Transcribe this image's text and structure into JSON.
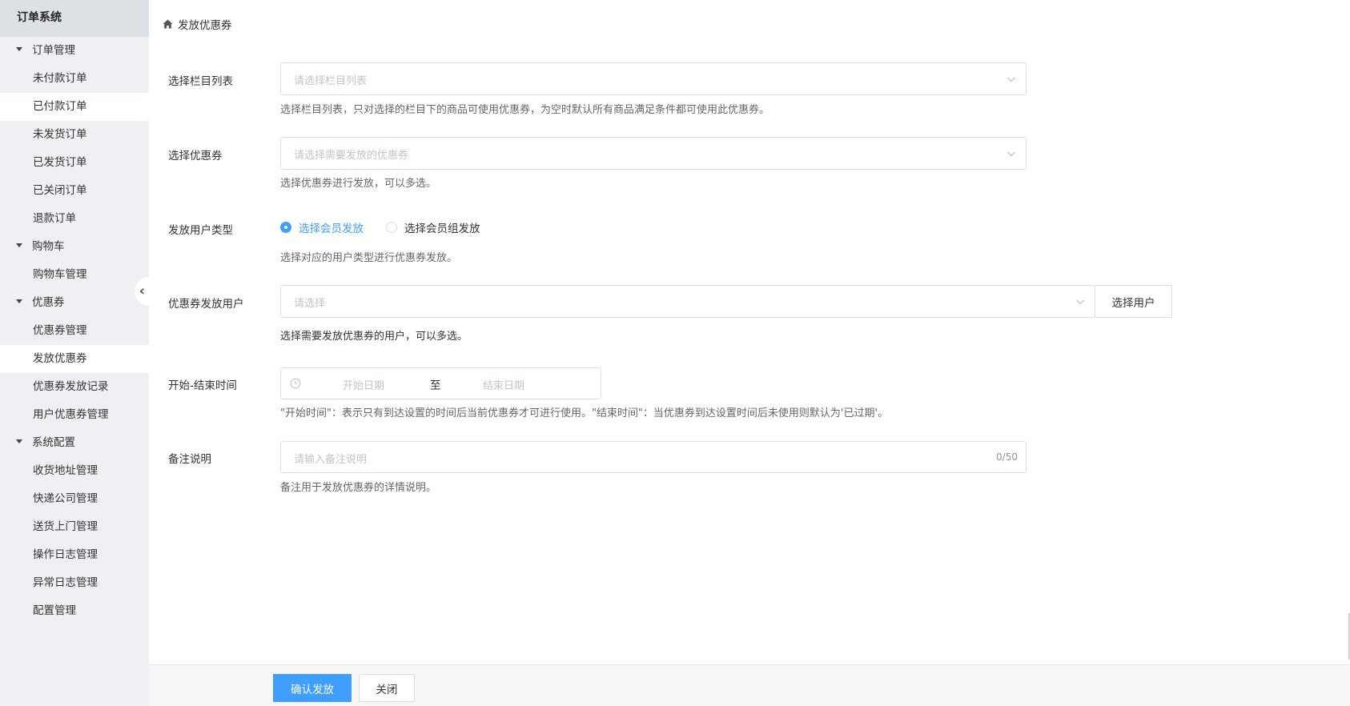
{
  "sidebar": {
    "title": "订单系统",
    "groups": [
      {
        "label": "订单管理",
        "items": [
          "未付款订单",
          "已付款订单",
          "未发货订单",
          "已发货订单",
          "已关闭订单",
          "退款订单"
        ]
      },
      {
        "label": "购物车",
        "items": [
          "购物车管理"
        ]
      },
      {
        "label": "优惠券",
        "items": [
          "优惠券管理",
          "发放优惠券",
          "优惠券发放记录",
          "用户优惠券管理"
        ]
      },
      {
        "label": "系统配置",
        "items": [
          "收货地址管理",
          "快递公司管理",
          "送货上门管理",
          "操作日志管理",
          "异常日志管理",
          "配置管理"
        ]
      }
    ]
  },
  "breadcrumb": {
    "current": "发放优惠券"
  },
  "form": {
    "column_list": {
      "label": "选择栏目列表",
      "placeholder": "请选择栏目列表",
      "hint": "选择栏目列表，只对选择的栏目下的商品可使用优惠券，为空时默认所有商品满足条件都可使用此优惠券。"
    },
    "coupon": {
      "label": "选择优惠券",
      "placeholder": "请选择需要发放的优惠券",
      "hint": "选择优惠券进行发放，可以多选。"
    },
    "user_type": {
      "label": "发放用户类型",
      "options": [
        "选择会员发放",
        "选择会员组发放"
      ],
      "selected": "选择会员发放",
      "hint": "选择对应的用户类型进行优惠券发放。"
    },
    "users": {
      "label": "优惠券发放用户",
      "placeholder": "请选择",
      "button": "选择用户",
      "hint": "选择需要发放优惠券的用户，可以多选。"
    },
    "time_range": {
      "label": "开始-结束时间",
      "start_placeholder": "开始日期",
      "separator": "至",
      "end_placeholder": "结束日期",
      "hint": "\"开始时间\"：表示只有到达设置的时间后当前优惠券才可进行使用。\"结束时间\"：当优惠券到达设置时间后未使用则默认为'已过期'。"
    },
    "remark": {
      "label": "备注说明",
      "placeholder": "请输入备注说明",
      "counter": "0/50",
      "hint": "备注用于发放优惠券的详情说明。"
    }
  },
  "footer": {
    "confirm": "确认发放",
    "close": "关闭"
  },
  "colors": {
    "primary": "#409eff",
    "sidebar_bg": "#eef0f3",
    "sidebar_title_bg": "#dde0e5"
  }
}
